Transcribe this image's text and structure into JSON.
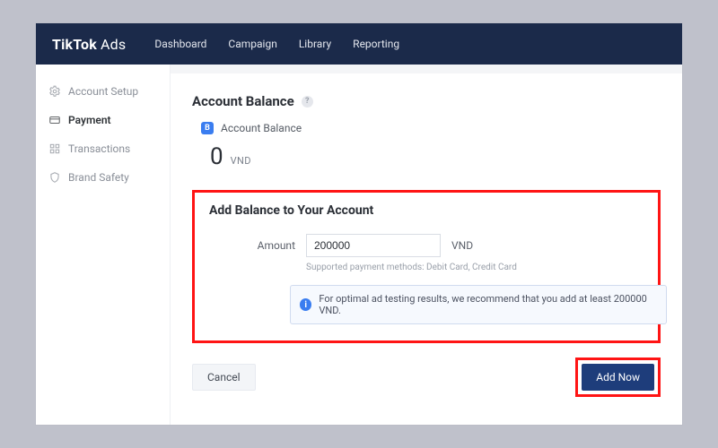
{
  "colors": {
    "navy": "#1b2a4a",
    "red": "#ff1414",
    "primary_btn": "#1e3d7b",
    "blue": "#3a7df0"
  },
  "brand": {
    "name": "TikTok",
    "suffix": "Ads"
  },
  "topnav": {
    "items": [
      "Dashboard",
      "Campaign",
      "Library",
      "Reporting"
    ]
  },
  "sidebar": {
    "items": [
      {
        "label": "Account Setup",
        "icon": "gear-icon",
        "active": false
      },
      {
        "label": "Payment",
        "icon": "card-icon",
        "active": true
      },
      {
        "label": "Transactions",
        "icon": "grid-icon",
        "active": false
      },
      {
        "label": "Brand Safety",
        "icon": "shield-icon",
        "active": false
      }
    ]
  },
  "balance": {
    "section_title": "Account Balance",
    "badge_letter": "B",
    "label": "Account Balance",
    "value": "0",
    "currency": "VND"
  },
  "add_balance": {
    "title": "Add Balance to Your Account",
    "amount_label": "Amount",
    "amount_value": "200000",
    "amount_unit": "VND",
    "supported_text": "Supported payment methods: Debit Card, Credit Card",
    "info_text": "For optimal ad testing results, we recommend that you add at least 200000 VND."
  },
  "footer": {
    "cancel": "Cancel",
    "add_now": "Add Now"
  }
}
